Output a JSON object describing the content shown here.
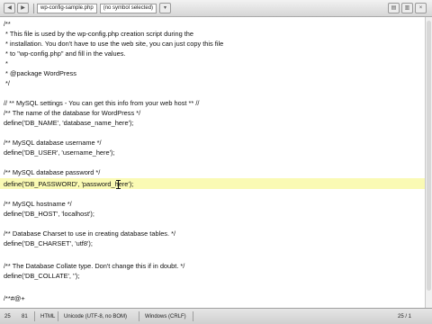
{
  "toolbar": {
    "file_name": "wp-config-sample.php",
    "symbol_selector": "(no symbol selected)"
  },
  "editor": {
    "lines": [
      "/**",
      " * This file is used by the wp-config.php creation script during the",
      " * installation. You don't have to use the web site, you can just copy this file",
      " * to \"wp-config.php\" and fill in the values.",
      " *",
      " * @package WordPress",
      " */",
      "",
      "// ** MySQL settings - You can get this info from your web host ** //",
      "/** The name of the database for WordPress */",
      "define('DB_NAME', 'database_name_here');",
      "",
      "/** MySQL database username */",
      "define('DB_USER', 'username_here');",
      "",
      "/** MySQL database password */",
      "define('DB_PASSWORD', 'password_here');",
      "",
      "/** MySQL hostname */",
      "define('DB_HOST', 'localhost');",
      "",
      "/** Database Charset to use in creating database tables. */",
      "define('DB_CHARSET', 'utf8');",
      "",
      "/** The Database Collate type. Don't change this if in doubt. */",
      "define('DB_COLLATE', '');",
      "",
      "/**#@+"
    ]
  },
  "statusbar": {
    "line": "25",
    "column": "81",
    "language": "HTML",
    "encoding": "Unicode (UTF-8, no BOM)",
    "line_endings": "Windows (CRLF)",
    "position": "25 / 1"
  }
}
